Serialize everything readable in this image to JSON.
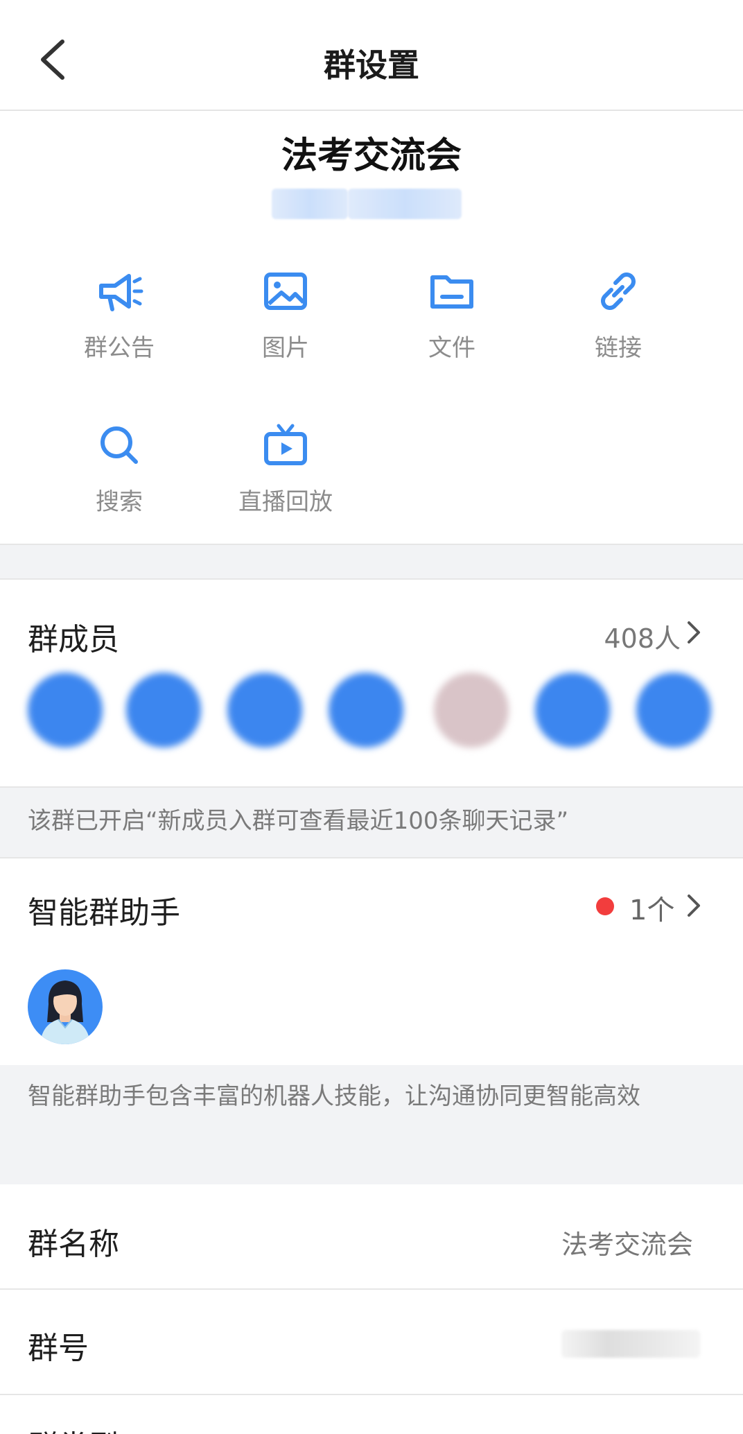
{
  "header": {
    "title": "群设置"
  },
  "group": {
    "name": "法考交流会"
  },
  "features": [
    {
      "label": "群公告",
      "icon": "megaphone-icon"
    },
    {
      "label": "图片",
      "icon": "image-icon"
    },
    {
      "label": "文件",
      "icon": "folder-icon"
    },
    {
      "label": "链接",
      "icon": "link-icon"
    },
    {
      "label": "搜索",
      "icon": "search-icon"
    },
    {
      "label": "直播回放",
      "icon": "tv-replay-icon"
    }
  ],
  "members": {
    "label": "群成员",
    "count": "408人",
    "notice": "该群已开启“新成员入群可查看最近100条聊天记录”"
  },
  "assistant": {
    "label": "智能群助手",
    "count": "1个",
    "description": "智能群助手包含丰富的机器人技能，让沟通协同更智能高效"
  },
  "settings": {
    "group_name_label": "群名称",
    "group_name_value": "法考交流会",
    "group_number_label": "群号",
    "partial_label": "群类型"
  },
  "colors": {
    "accent": "#3b8cf0",
    "dot": "#f23d3d",
    "gray_bg": "#f2f3f5"
  }
}
